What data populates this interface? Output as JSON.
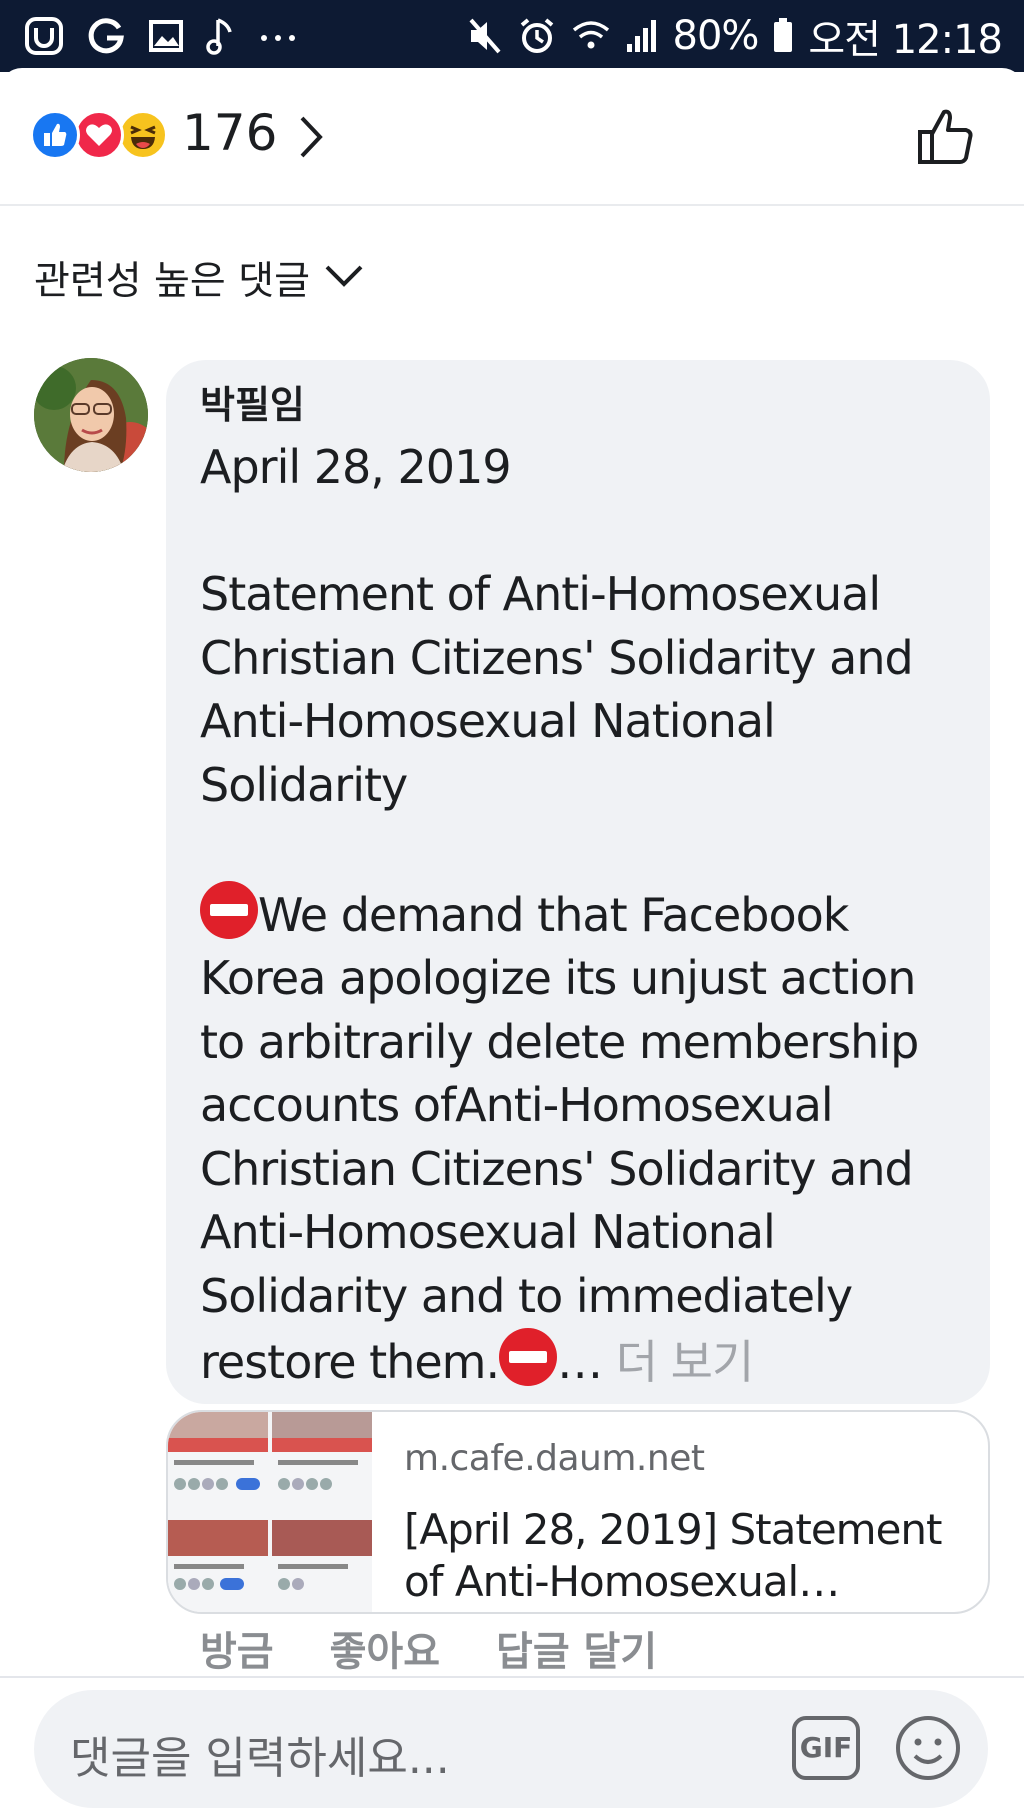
{
  "status_bar": {
    "battery": "80%",
    "time": "오전 12:18",
    "left_icons": [
      "app-icon",
      "g-icon",
      "image-icon",
      "music-note-icon",
      "more-dots-icon"
    ],
    "right_icons": [
      "mute-icon",
      "alarm-icon",
      "wifi-icon",
      "signal-icon",
      "battery-icon"
    ]
  },
  "reactions": {
    "types": [
      "like",
      "love",
      "haha"
    ],
    "count": "176"
  },
  "sort": {
    "label": "관련성 높은 댓글"
  },
  "comment": {
    "author": "박필임",
    "body_lines": [
      "April 28, 2019",
      "",
      "Statement of Anti-Homosexual",
      "Christian Citizens' Solidarity and",
      "Anti-Homosexual National",
      "Solidarity",
      "",
      "We demand that Facebook",
      "Korea apologize its unjust action",
      "to arbitrarily delete membership",
      "accounts ofAnti-Homosexual",
      "Christian Citizens' Solidarity and",
      "Anti-Homosexual National",
      "Solidarity and to immediately",
      "restore them."
    ],
    "ellipsis": "…",
    "see_more": "더 보기"
  },
  "link_preview": {
    "domain": "m.cafe.daum.net",
    "title": "[April 28, 2019] Statement of Anti-Homosexual…"
  },
  "comment_actions": {
    "time": "방금",
    "like": "좋아요",
    "reply": "답글 달기"
  },
  "composer": {
    "placeholder": "댓글을 입력하세요...",
    "gif_label": "GIF"
  },
  "colors": {
    "status_bar": "#0d1a33",
    "bubble": "#f0f2f5",
    "like_blue": "#1877f2",
    "love_red": "#f0284a",
    "haha_yellow": "#f7c31e",
    "stop_red": "#e0202a",
    "muted_text": "#65676b"
  }
}
